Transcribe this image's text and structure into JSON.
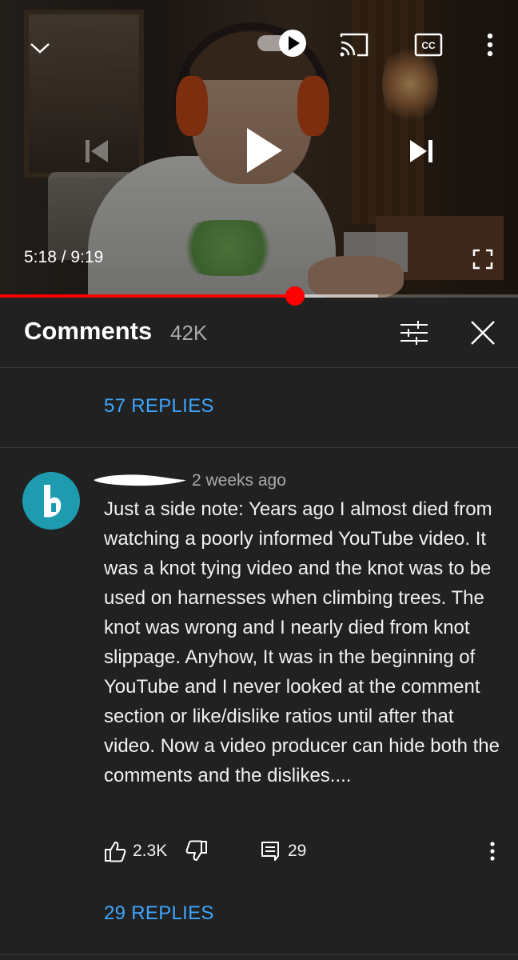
{
  "player": {
    "current_time": "5:18",
    "duration": "9:19",
    "time_separator": " / ",
    "progress_fraction": 0.569,
    "buffer_fraction": 0.73,
    "autoplay_on": true,
    "icons": [
      "chevron-down-icon",
      "autoplay-toggle-icon",
      "cast-icon",
      "captions-icon",
      "more-vert-icon",
      "previous-icon",
      "play-icon",
      "next-icon",
      "fullscreen-icon"
    ],
    "colors": {
      "progress": "#ff0000"
    }
  },
  "comments_panel": {
    "title": "Comments",
    "count": "42K",
    "icons": [
      "sort-filter-icon",
      "close-icon"
    ]
  },
  "prev_thread": {
    "replies_label": "57 REPLIES"
  },
  "comment": {
    "time": "2 weeks ago",
    "text": "Just a side note: Years ago I almost died from watching a poorly informed YouTube video. It was a knot tying video and the knot was to be used on harnesses when climbing trees. The knot was wrong and I nearly died from knot slippage. Anyhow, It was in the beginning of YouTube and I never looked at the comment section or like/dislike ratios until after that video. Now a video producer can hide both the comments and the dislikes....",
    "likes": "2.3K",
    "reply_count": "29",
    "replies_label": "29 REPLIES",
    "avatar_color": "#1f9bb0"
  },
  "colors": {
    "background": "#212121",
    "link": "#3ea6ff",
    "muted": "#aaaaaa"
  }
}
